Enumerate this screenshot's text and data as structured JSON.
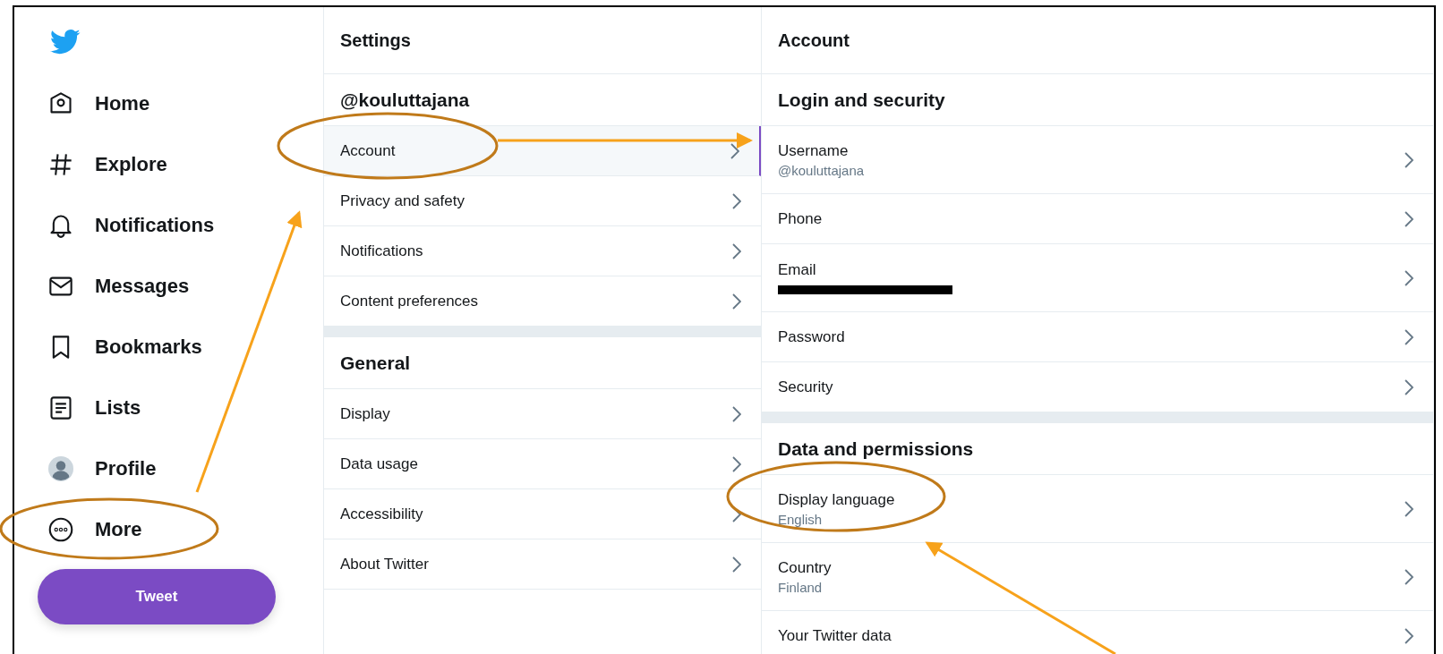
{
  "nav": {
    "items": [
      {
        "label": "Home",
        "kind": "home"
      },
      {
        "label": "Explore",
        "kind": "hash"
      },
      {
        "label": "Notifications",
        "kind": "bell"
      },
      {
        "label": "Messages",
        "kind": "mail"
      },
      {
        "label": "Bookmarks",
        "kind": "bookmark"
      },
      {
        "label": "Lists",
        "kind": "list"
      },
      {
        "label": "Profile",
        "kind": "avatar"
      },
      {
        "label": "More",
        "kind": "more"
      }
    ],
    "tweet_button": "Tweet"
  },
  "settings": {
    "title": "Settings",
    "sections": [
      {
        "heading": "@kouluttajana",
        "items": [
          {
            "label": "Account",
            "selected": true
          },
          {
            "label": "Privacy and safety",
            "selected": false
          },
          {
            "label": "Notifications",
            "selected": false
          },
          {
            "label": "Content preferences",
            "selected": false
          }
        ]
      },
      {
        "heading": "General",
        "items": [
          {
            "label": "Display",
            "selected": false
          },
          {
            "label": "Data usage",
            "selected": false
          },
          {
            "label": "Accessibility",
            "selected": false
          },
          {
            "label": "About Twitter",
            "selected": false
          }
        ]
      }
    ]
  },
  "account": {
    "title": "Account",
    "sections": [
      {
        "heading": "Login and security",
        "items": [
          {
            "label": "Username",
            "value": "@kouluttajana"
          },
          {
            "label": "Phone"
          },
          {
            "label": "Email",
            "redacted": true
          },
          {
            "label": "Password"
          },
          {
            "label": "Security"
          }
        ]
      },
      {
        "heading": "Data and permissions",
        "items": [
          {
            "label": "Display language",
            "value": "English"
          },
          {
            "label": "Country",
            "value": "Finland"
          },
          {
            "label": "Your Twitter data"
          }
        ]
      }
    ]
  }
}
